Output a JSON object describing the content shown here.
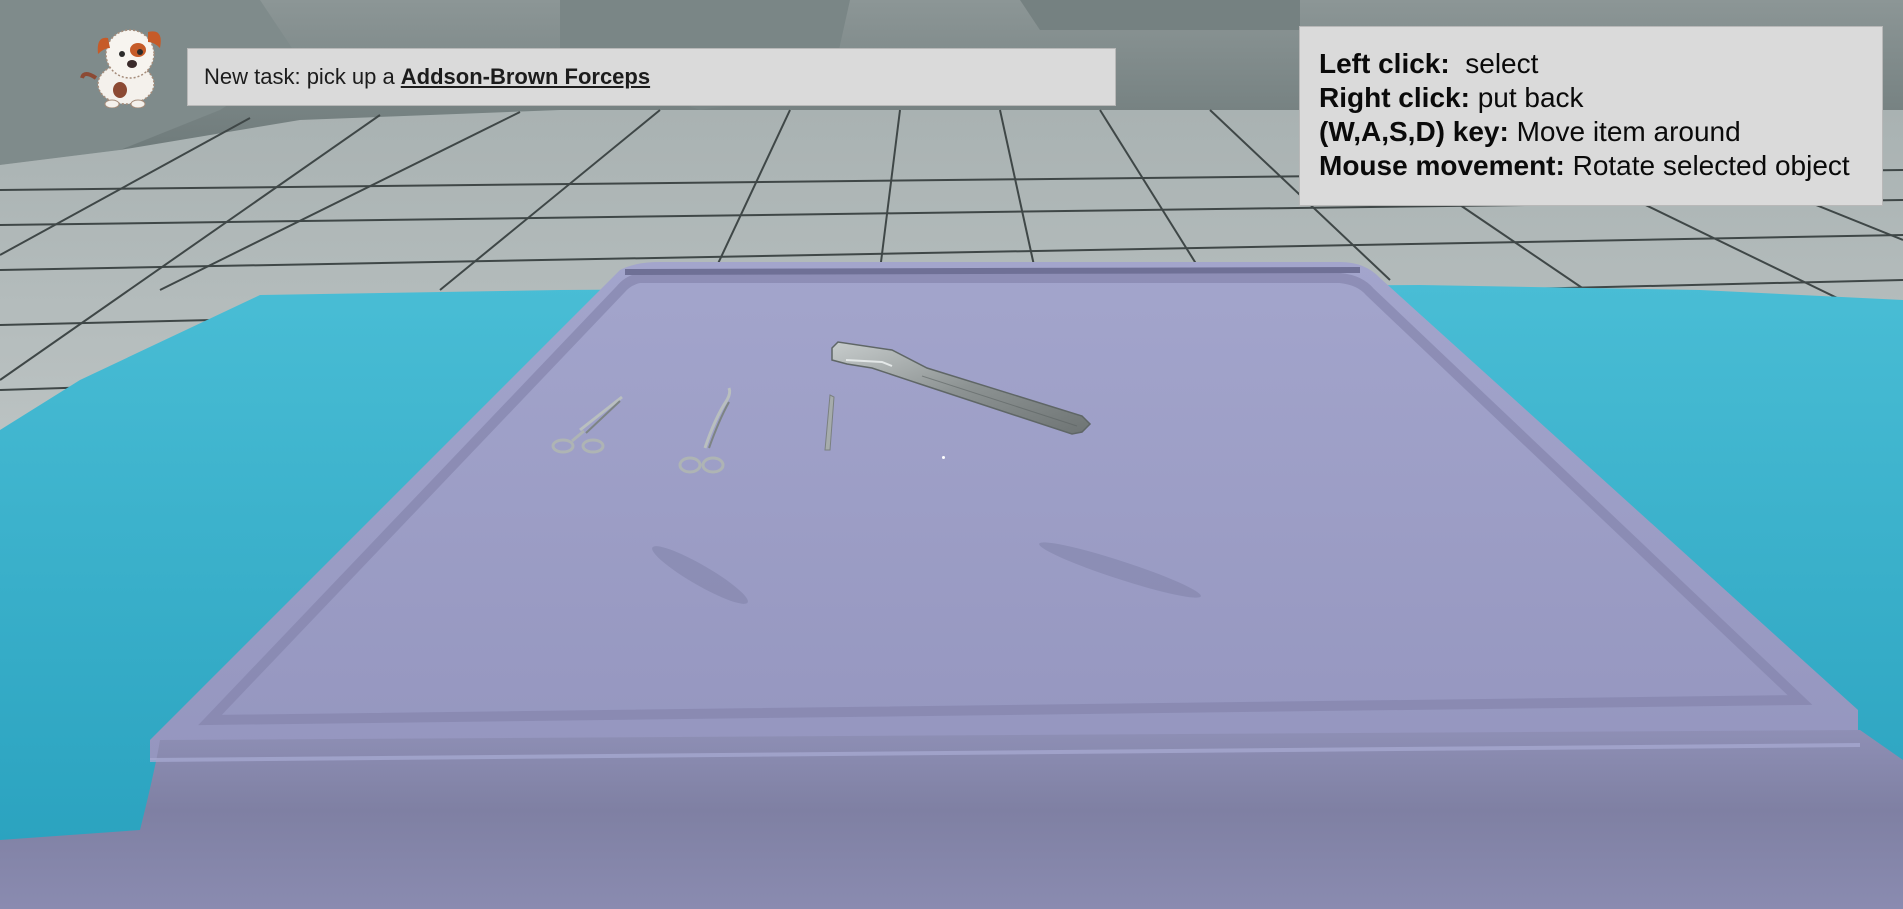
{
  "task": {
    "prefix": "New task: pick up a",
    "target_item": "Addson-Brown Forceps"
  },
  "controls": [
    {
      "key": "Left click:",
      "action": "  select"
    },
    {
      "key": "Right click:",
      "action": " put back"
    },
    {
      "key": "(W,A,S,D) key:",
      "action": " Move item around"
    },
    {
      "key": "Mouse movement:",
      "action": " Rotate selected object"
    }
  ],
  "mascot": {
    "icon": "puppy-icon"
  },
  "instruments": [
    {
      "icon": "straight-scissors-icon"
    },
    {
      "icon": "curved-scissors-icon"
    },
    {
      "icon": "scalpel-handle-icon"
    },
    {
      "icon": "forceps-icon"
    }
  ],
  "colors": {
    "drape": "#3fb3cc",
    "tray": "#9c9dc4",
    "floor": "#c9cfcf",
    "panel": "#dadada"
  }
}
